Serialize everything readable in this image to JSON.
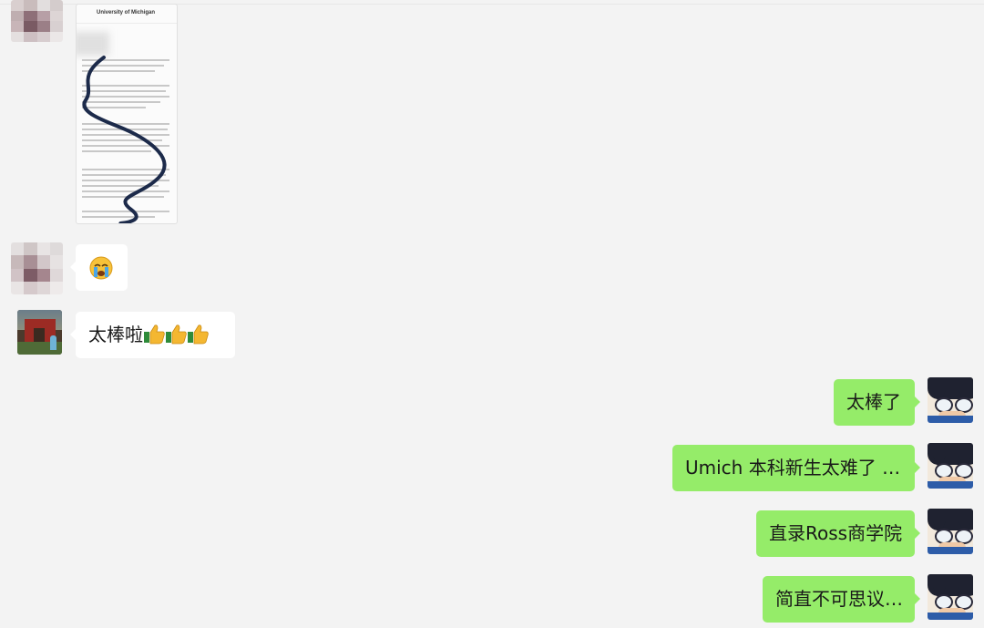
{
  "conversation": {
    "messages": [
      {
        "side": "left",
        "type": "image",
        "sender_avatar": "pixelated-avatar-1",
        "image_title": "University of Michigan"
      },
      {
        "side": "left",
        "type": "emoji",
        "sender_avatar": "pixelated-avatar-2",
        "emoji": "😭"
      },
      {
        "side": "left",
        "type": "text",
        "sender_avatar": "scenery-avatar",
        "text": "太棒啦"
      },
      {
        "side": "right",
        "type": "text",
        "sender_avatar": "anime-avatar",
        "text": "太棒了"
      },
      {
        "side": "right",
        "type": "text",
        "sender_avatar": "anime-avatar",
        "text": "Umich 本科新生太难了 …"
      },
      {
        "side": "right",
        "type": "text",
        "sender_avatar": "anime-avatar",
        "text": "直录Ross商学院"
      },
      {
        "side": "right",
        "type": "text",
        "sender_avatar": "anime-avatar",
        "text": "简直不可思议…"
      }
    ]
  },
  "icons": {
    "thumbs_up": "thumbs-up-icon",
    "crying": "crying-face-icon"
  },
  "colors": {
    "background": "#f3f3f3",
    "outgoing_bubble": "#95ec69",
    "incoming_bubble": "#ffffff"
  }
}
